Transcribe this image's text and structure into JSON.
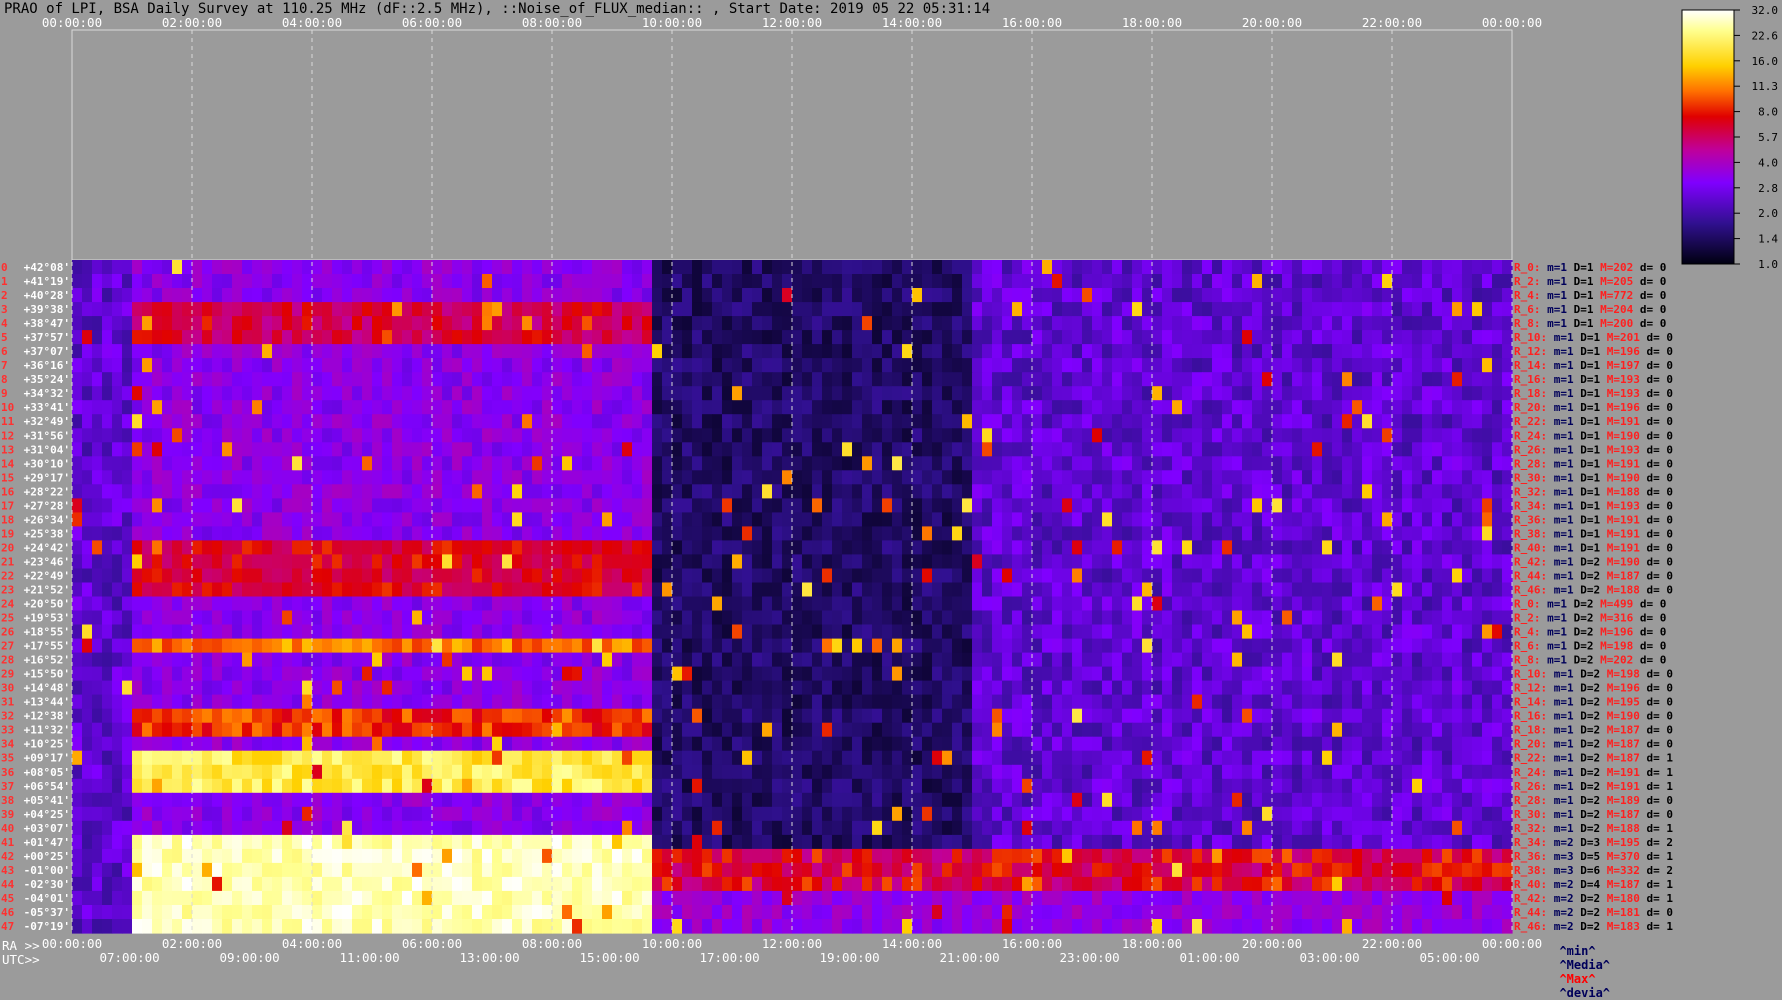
{
  "title": "PRAO of LPI, BSA Daily Survey at 110.25 MHz (dF::2.5 MHz), ::Noise_of_FLUX_median:: , Start Date: 2019 05 22 05:31:14",
  "chart_data": {
    "type": "heatmap",
    "title": "PRAO of LPI, BSA Daily Survey at 110.25 MHz (dF::2.5 MHz), ::Noise_of_FLUX_median:: , Start Date: 2019 05 22 05:31:14",
    "top_x_ticks": [
      "00:00:00",
      "02:00:00",
      "04:00:00",
      "06:00:00",
      "08:00:00",
      "10:00:00",
      "12:00:00",
      "14:00:00",
      "16:00:00",
      "18:00:00",
      "20:00:00",
      "22:00:00",
      "00:00:00"
    ],
    "ra_axis_label": "RA >>",
    "ra_ticks": [
      "00:00:00",
      "02:00:00",
      "04:00:00",
      "06:00:00",
      "08:00:00",
      "10:00:00",
      "12:00:00",
      "14:00:00",
      "16:00:00",
      "18:00:00",
      "20:00:00",
      "22:00:00",
      "00:00:00"
    ],
    "utc_axis_label": "UTC>>",
    "utc_ticks": [
      "07:00:00",
      "09:00:00",
      "11:00:00",
      "13:00:00",
      "15:00:00",
      "17:00:00",
      "19:00:00",
      "21:00:00",
      "23:00:00",
      "01:00:00",
      "03:00:00",
      "05:00:00"
    ],
    "dec_ticks": [
      "+42°08'",
      "+41°19'",
      "+40°28'",
      "+39°38'",
      "+38°47'",
      "+37°57'",
      "+37°07'",
      "+36°16'",
      "+35°24'",
      "+34°32'",
      "+33°41'",
      "+32°49'",
      "+31°56'",
      "+31°04'",
      "+30°10'",
      "+29°17'",
      "+28°22'",
      "+27°28'",
      "+26°34'",
      "+25°38'",
      "+24°42'",
      "+23°46'",
      "+22°49'",
      "+21°52'",
      "+20°50'",
      "+19°53'",
      "+18°55'",
      "+17°55'",
      "+16°52'",
      "+15°50'",
      "+14°48'",
      "+13°44'",
      "+12°38'",
      "+11°32'",
      "+10°25'",
      "+09°17'",
      "+08°05'",
      "+06°54'",
      "+05°41'",
      "+04°25'",
      "+03°07'",
      "+01°47'",
      "+00°25'",
      "-01°00'",
      "-02°30'",
      "-04°01'",
      "-05°37'",
      "-07°19'"
    ],
    "colorbar": {
      "ticks": [
        "32.0",
        "22.6",
        "16.0",
        "11.3",
        "8.0",
        "5.7",
        "4.0",
        "2.8",
        "2.0",
        "1.4",
        "1.0"
      ],
      "colors": [
        "#ffffff",
        "#ffff80",
        "#ffd000",
        "#ff6000",
        "#e00000",
        "#c0009a",
        "#8000ff",
        "#30108f",
        "#000010"
      ]
    },
    "row_labels": [
      {
        "r": "R_0:",
        "m": "m=1",
        "D": "D=1",
        "M": "M=202",
        "d": "d= 0"
      },
      {
        "r": "R_2:",
        "m": "m=1",
        "D": "D=1",
        "M": "M=205",
        "d": "d= 0"
      },
      {
        "r": "R_4:",
        "m": "m=1",
        "D": "D=1",
        "M": "M=772",
        "d": "d= 0"
      },
      {
        "r": "R_6:",
        "m": "m=1",
        "D": "D=1",
        "M": "M=204",
        "d": "d= 0"
      },
      {
        "r": "R_8:",
        "m": "m=1",
        "D": "D=1",
        "M": "M=200",
        "d": "d= 0"
      },
      {
        "r": "R_10:",
        "m": "m=1",
        "D": "D=1",
        "M": "M=201",
        "d": "d= 0"
      },
      {
        "r": "R_12:",
        "m": "m=1",
        "D": "D=1",
        "M": "M=196",
        "d": "d= 0"
      },
      {
        "r": "R_14:",
        "m": "m=1",
        "D": "D=1",
        "M": "M=197",
        "d": "d= 0"
      },
      {
        "r": "R_16:",
        "m": "m=1",
        "D": "D=1",
        "M": "M=193",
        "d": "d= 0"
      },
      {
        "r": "R_18:",
        "m": "m=1",
        "D": "D=1",
        "M": "M=193",
        "d": "d= 0"
      },
      {
        "r": "R_20:",
        "m": "m=1",
        "D": "D=1",
        "M": "M=196",
        "d": "d= 0"
      },
      {
        "r": "R_22:",
        "m": "m=1",
        "D": "D=1",
        "M": "M=191",
        "d": "d= 0"
      },
      {
        "r": "R_24:",
        "m": "m=1",
        "D": "D=1",
        "M": "M=190",
        "d": "d= 0"
      },
      {
        "r": "R_26:",
        "m": "m=1",
        "D": "D=1",
        "M": "M=193",
        "d": "d= 0"
      },
      {
        "r": "R_28:",
        "m": "m=1",
        "D": "D=1",
        "M": "M=191",
        "d": "d= 0"
      },
      {
        "r": "R_30:",
        "m": "m=1",
        "D": "D=1",
        "M": "M=190",
        "d": "d= 0"
      },
      {
        "r": "R_32:",
        "m": "m=1",
        "D": "D=1",
        "M": "M=188",
        "d": "d= 0"
      },
      {
        "r": "R_34:",
        "m": "m=1",
        "D": "D=1",
        "M": "M=193",
        "d": "d= 0"
      },
      {
        "r": "R_36:",
        "m": "m=1",
        "D": "D=1",
        "M": "M=191",
        "d": "d= 0"
      },
      {
        "r": "R_38:",
        "m": "m=1",
        "D": "D=1",
        "M": "M=191",
        "d": "d= 0"
      },
      {
        "r": "R_40:",
        "m": "m=1",
        "D": "D=1",
        "M": "M=191",
        "d": "d= 0"
      },
      {
        "r": "R_42:",
        "m": "m=1",
        "D": "D=2",
        "M": "M=190",
        "d": "d= 0"
      },
      {
        "r": "R_44:",
        "m": "m=1",
        "D": "D=2",
        "M": "M=187",
        "d": "d= 0"
      },
      {
        "r": "R_46:",
        "m": "m=1",
        "D": "D=2",
        "M": "M=188",
        "d": "d= 0"
      },
      {
        "r": "R_0:",
        "m": "m=1",
        "D": "D=2",
        "M": "M=499",
        "d": "d= 0"
      },
      {
        "r": "R_2:",
        "m": "m=1",
        "D": "D=2",
        "M": "M=316",
        "d": "d= 0"
      },
      {
        "r": "R_4:",
        "m": "m=1",
        "D": "D=2",
        "M": "M=196",
        "d": "d= 0"
      },
      {
        "r": "R_6:",
        "m": "m=1",
        "D": "D=2",
        "M": "M=198",
        "d": "d= 0"
      },
      {
        "r": "R_8:",
        "m": "m=1",
        "D": "D=2",
        "M": "M=202",
        "d": "d= 0"
      },
      {
        "r": "R_10:",
        "m": "m=1",
        "D": "D=2",
        "M": "M=198",
        "d": "d= 0"
      },
      {
        "r": "R_12:",
        "m": "m=1",
        "D": "D=2",
        "M": "M=196",
        "d": "d= 0"
      },
      {
        "r": "R_14:",
        "m": "m=1",
        "D": "D=2",
        "M": "M=195",
        "d": "d= 0"
      },
      {
        "r": "R_16:",
        "m": "m=1",
        "D": "D=2",
        "M": "M=190",
        "d": "d= 0"
      },
      {
        "r": "R_18:",
        "m": "m=1",
        "D": "D=2",
        "M": "M=187",
        "d": "d= 0"
      },
      {
        "r": "R_20:",
        "m": "m=1",
        "D": "D=2",
        "M": "M=187",
        "d": "d= 0"
      },
      {
        "r": "R_22:",
        "m": "m=1",
        "D": "D=2",
        "M": "M=187",
        "d": "d= 1"
      },
      {
        "r": "R_24:",
        "m": "m=1",
        "D": "D=2",
        "M": "M=191",
        "d": "d= 1"
      },
      {
        "r": "R_26:",
        "m": "m=1",
        "D": "D=2",
        "M": "M=191",
        "d": "d= 1"
      },
      {
        "r": "R_28:",
        "m": "m=1",
        "D": "D=2",
        "M": "M=189",
        "d": "d= 0"
      },
      {
        "r": "R_30:",
        "m": "m=1",
        "D": "D=2",
        "M": "M=187",
        "d": "d= 0"
      },
      {
        "r": "R_32:",
        "m": "m=1",
        "D": "D=2",
        "M": "M=188",
        "d": "d= 1"
      },
      {
        "r": "R_34:",
        "m": "m=2",
        "D": "D=3",
        "M": "M=195",
        "d": "d= 2"
      },
      {
        "r": "R_36:",
        "m": "m=3",
        "D": "D=5",
        "M": "M=370",
        "d": "d= 1"
      },
      {
        "r": "R_38:",
        "m": "m=3",
        "D": "D=6",
        "M": "M=332",
        "d": "d= 2"
      },
      {
        "r": "R_40:",
        "m": "m=2",
        "D": "D=4",
        "M": "M=187",
        "d": "d= 1"
      },
      {
        "r": "R_42:",
        "m": "m=2",
        "D": "D=2",
        "M": "M=180",
        "d": "d= 1"
      },
      {
        "r": "R_44:",
        "m": "m=2",
        "D": "D=2",
        "M": "M=181",
        "d": "d= 0"
      },
      {
        "r": "R_46:",
        "m": "m=2",
        "D": "D=2",
        "M": "M=183",
        "d": "d= 1"
      }
    ],
    "legend": [
      "^min^",
      "^Media^",
      "^Max^",
      "^devia^"
    ],
    "legend_colors": [
      "#00005a",
      "#00005a",
      "#ff0000",
      "#00005a"
    ]
  }
}
